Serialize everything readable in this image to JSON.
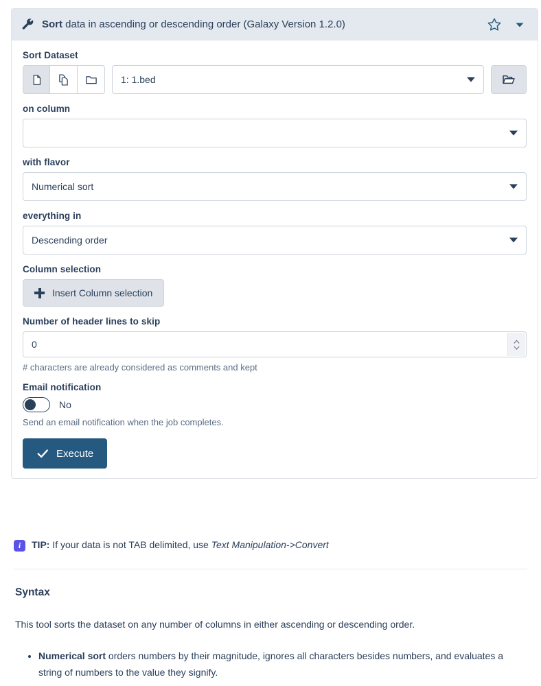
{
  "header": {
    "wrench_icon": "wrench-icon",
    "title_bold": "Sort",
    "title_rest": " data in ascending or descending order (Galaxy Version 1.2.0)",
    "favorite_icon": "star-icon",
    "options_icon": "chevron-down-icon",
    "bg_color": "#e3e9ef",
    "accent_color": "#25597f"
  },
  "form": {
    "dataset": {
      "label": "Sort Dataset",
      "mode_buttons": [
        {
          "name": "single-dataset",
          "icon": "file-icon",
          "active": true
        },
        {
          "name": "multiple-datasets",
          "icon": "copy-files-icon",
          "active": false
        },
        {
          "name": "dataset-collection",
          "icon": "folder-icon",
          "active": false
        }
      ],
      "selected_value": "1: 1.bed",
      "browse_icon": "open-folder-icon"
    },
    "on_column": {
      "label": "on column",
      "selected_value": ""
    },
    "flavor": {
      "label": "with flavor",
      "selected_value": "Numerical sort"
    },
    "order": {
      "label": "everything in",
      "selected_value": "Descending order"
    },
    "column_selection": {
      "label": "Column selection",
      "insert_button": "Insert Column selection"
    },
    "header_lines": {
      "label": "Number of header lines to skip",
      "value": "0",
      "help": "# characters are already considered as comments and kept"
    },
    "email_notification": {
      "label": "Email notification",
      "toggle_state": "No",
      "toggle_on": false,
      "help": "Send an email notification when the job completes."
    },
    "execute": {
      "label": "Execute",
      "icon": "check-icon"
    }
  },
  "tip": {
    "icon": "info-icon",
    "bold": "TIP:",
    "text": " If your data is not TAB delimited, use ",
    "italic": "Text Manipulation->Convert"
  },
  "syntax": {
    "heading": "Syntax",
    "paragraph": "This tool sorts the dataset on any number of columns in either ascending or descending order.",
    "bullets": [
      {
        "bold": "Numerical sort",
        "text": " orders numbers by their magnitude, ignores all characters besides numbers, and evaluates a string of numbers to the value they signify."
      }
    ]
  }
}
